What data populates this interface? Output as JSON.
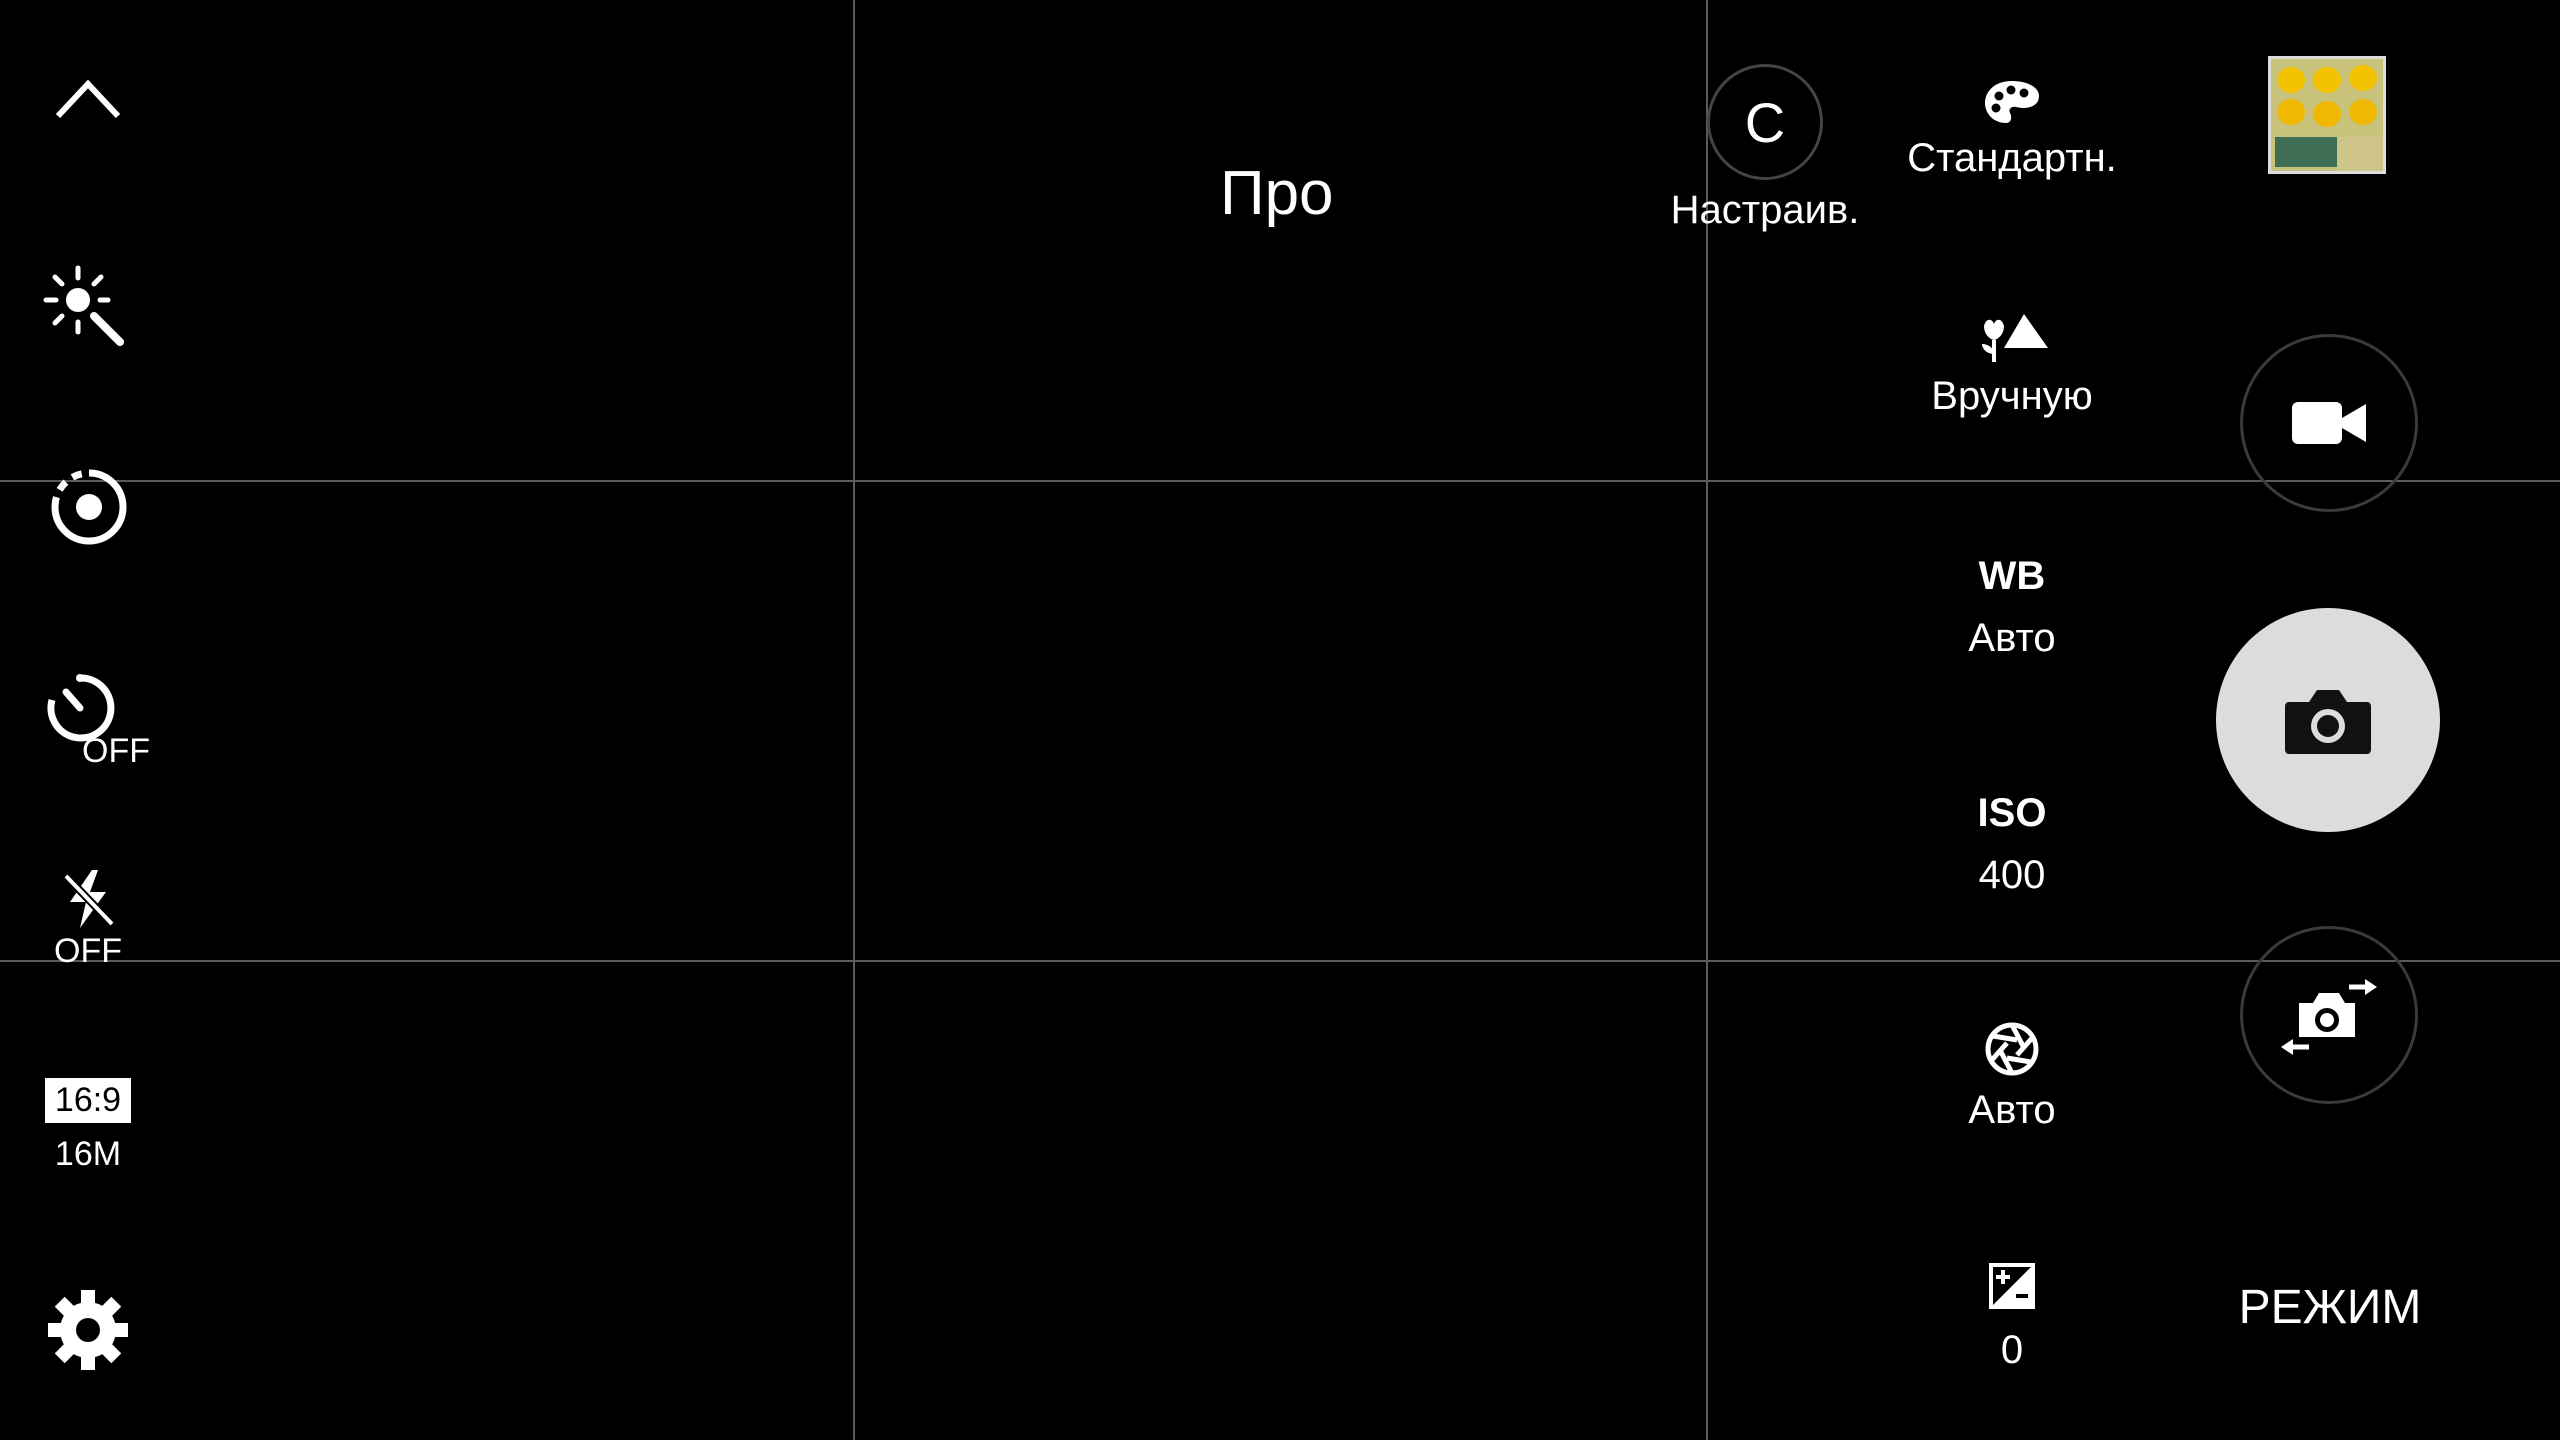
{
  "mode_title": "Про",
  "left_bar": {
    "collapse_icon": "chevron-up-icon",
    "filter_icon": "auto-enhance-icon",
    "metering_icon": "metering-icon",
    "timer": {
      "icon": "timer-icon",
      "label": "OFF"
    },
    "flash": {
      "icon": "flash-off-icon",
      "label": "OFF"
    },
    "ratio": {
      "aspect": "16:9",
      "resolution": "16M"
    },
    "settings_icon": "gear-icon"
  },
  "pro_settings": {
    "custom": {
      "letter": "C",
      "label": "Настраив."
    },
    "tone": {
      "icon": "palette-icon",
      "label": "Стандартн."
    },
    "focus": {
      "icon": "macro-landscape-icon",
      "label": "Вручную"
    },
    "wb": {
      "title": "WB",
      "value": "Авто"
    },
    "iso": {
      "title": "ISO",
      "value": "400"
    },
    "shutter": {
      "icon": "aperture-icon",
      "value": "Авто"
    },
    "exposure": {
      "icon": "exposure-icon",
      "value": "0"
    }
  },
  "right_bar": {
    "gallery_icon": "gallery-thumbnail-icon",
    "video_icon": "video-camera-icon",
    "shutter_icon": "camera-icon",
    "switch_icon": "switch-camera-icon",
    "mode_label": "РЕЖИМ"
  }
}
